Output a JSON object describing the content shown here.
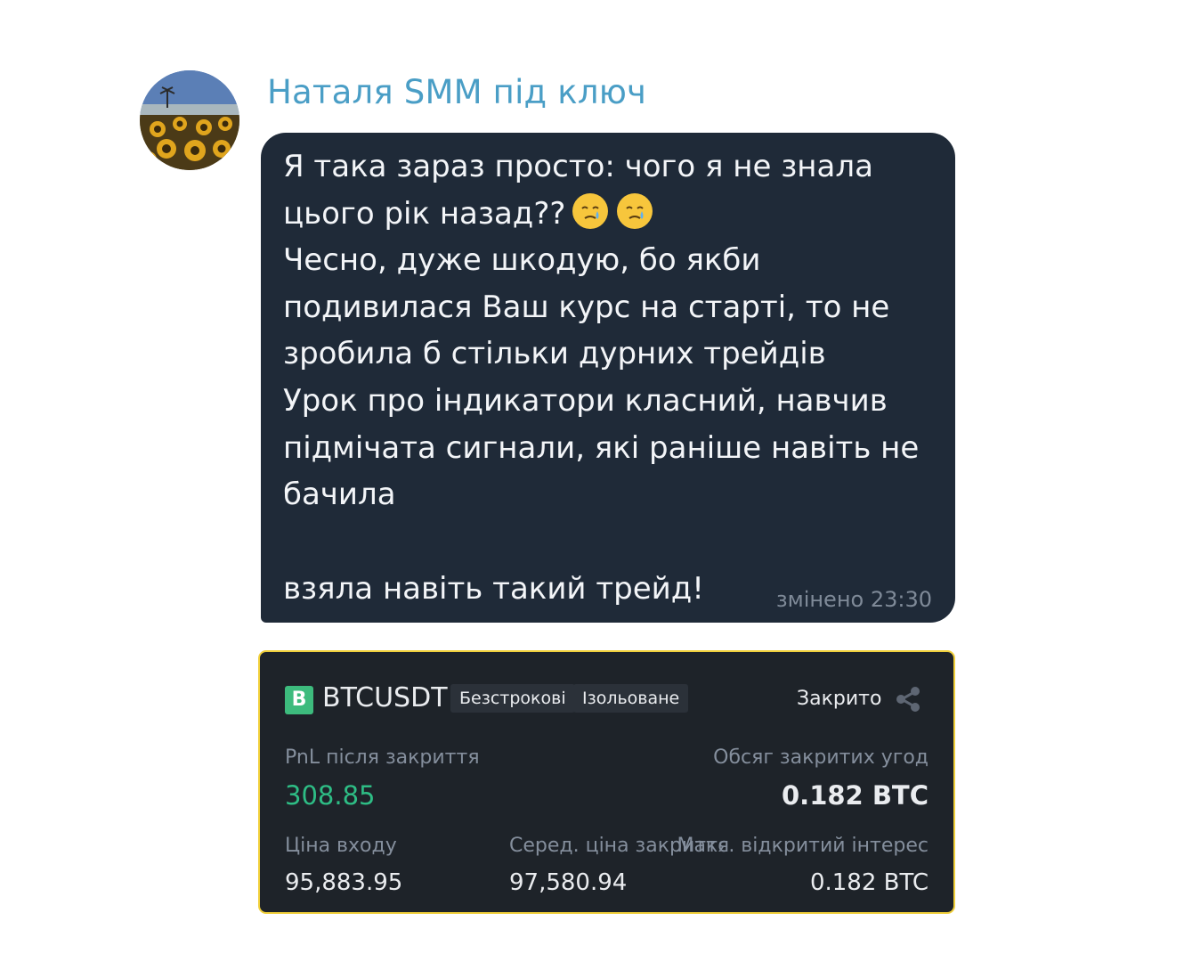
{
  "chat": {
    "sender_name": "Наталя SMM під ключ",
    "message": {
      "text": "Я така зараз просто: чого я не знала\nцього рік назад??",
      "emoji": "face-holding-back-tears",
      "text_cont": "Чесно, дуже шкодую, бо якби\nподивилася Ваш курс на старті, то не\nзробила б стільки дурних трейдів\nУрок про індикатори класний, навчив\nпідмічата сигнали, які раніше навіть не\nбачила",
      "last_line": "взяла навіть такий трейд!",
      "meta": "змінено 23:30"
    }
  },
  "trade_card": {
    "badge": "B",
    "symbol": "BTCUSDT",
    "tags": [
      "Безстрокові",
      "Ізольоване"
    ],
    "status": "Закрито",
    "pnl_label": "PnL після закриття",
    "pnl_value": "308.85",
    "volume_label": "Обсяг закритих угод",
    "volume_value": "0.182 BTC",
    "entry_label": "Ціна входу",
    "entry_value": "95,883.95",
    "avg_close_label": "Серед. ціна закриття",
    "avg_close_value": "97,580.94",
    "max_oi_label": "Макс. відкритий інтерес",
    "max_oi_value": "0.182 BTC",
    "colors": {
      "accent_border": "#f0cf3a",
      "positive": "#2ebd85",
      "badge": "#3dbb7d"
    }
  }
}
